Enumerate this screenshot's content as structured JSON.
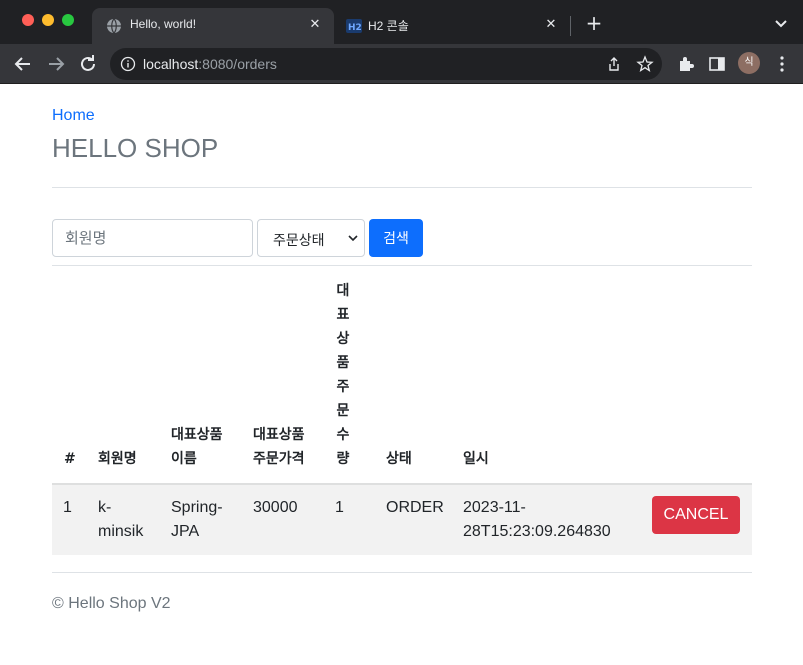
{
  "browser": {
    "tabs": [
      {
        "title": "Hello, world!",
        "icon": "globe-icon",
        "active": true
      },
      {
        "title": "H2 콘솔",
        "icon": "h2-icon",
        "active": false
      }
    ],
    "url": {
      "host": "localhost",
      "rest": ":8080/orders"
    },
    "profile_initial": "식"
  },
  "nav": {
    "home": "Home",
    "brand": "HELLO SHOP"
  },
  "search": {
    "member_placeholder": "회원명",
    "status_label": "주문상태",
    "search_button": "검색"
  },
  "table": {
    "headers": {
      "index": "#",
      "member": "회원명",
      "item_name": [
        "대표상품",
        "이름"
      ],
      "item_price": [
        "대표상품",
        "주문가격"
      ],
      "item_count": [
        "대",
        "표",
        "상",
        "품",
        "주",
        "문",
        "수",
        "량"
      ],
      "status": "상태",
      "date": "일시"
    },
    "rows": [
      {
        "index": "1",
        "member": [
          "k-",
          "minsik"
        ],
        "item_name": [
          "Spring-",
          "JPA"
        ],
        "price": "30000",
        "count": "1",
        "status": "ORDER",
        "date": [
          "2023-11-",
          "28T15:23:09.264830"
        ],
        "action": "CANCEL"
      }
    ]
  },
  "footer": "© Hello Shop V2",
  "colors": {
    "primary": "#0d6efd",
    "danger": "#dc3545",
    "chrome_dark": "#202124"
  }
}
